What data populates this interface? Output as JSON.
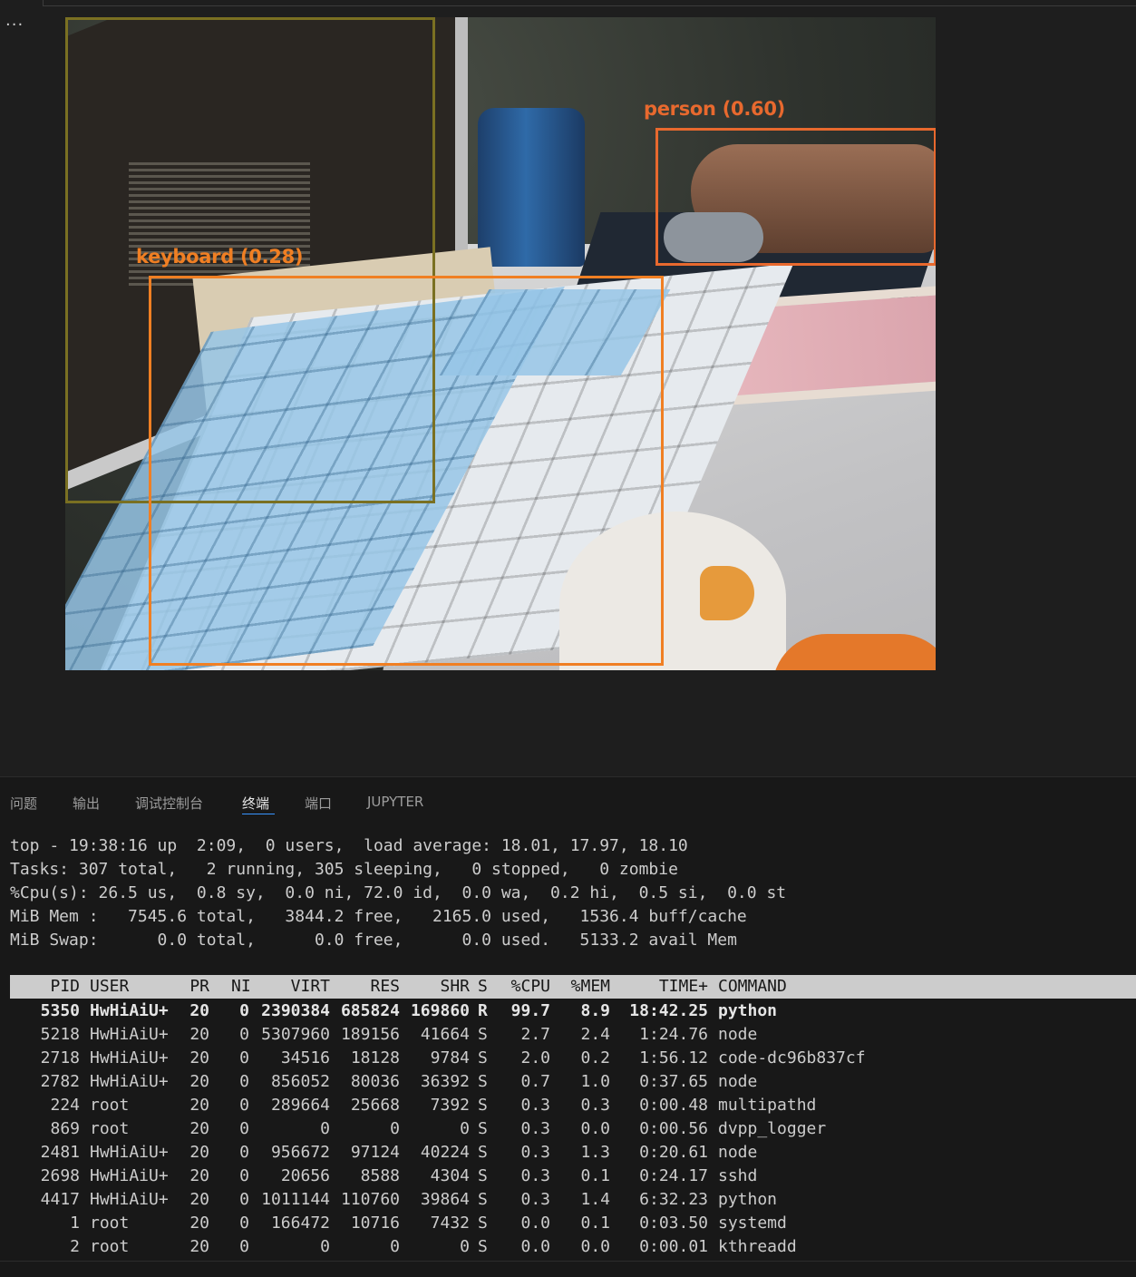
{
  "notebook": {
    "more_icon": "more-horizontal-icon",
    "detections": [
      {
        "label": "person (0.60)",
        "color": "#e8692e"
      },
      {
        "label": "keyboard (0.28)",
        "color": "#f07f23"
      },
      {
        "label": "",
        "color": "#7a7022"
      }
    ]
  },
  "panel": {
    "tabs": [
      "问题",
      "输出",
      "调试控制台",
      "终端",
      "端口",
      "JUPYTER"
    ],
    "active_tab": "终端"
  },
  "terminal": {
    "summary": [
      "top - 19:38:16 up  2:09,  0 users,  load average: 18.01, 17.97, 18.10",
      "Tasks: 307 total,   2 running, 305 sleeping,   0 stopped,   0 zombie",
      "%Cpu(s): 26.5 us,  0.8 sy,  0.0 ni, 72.0 id,  0.0 wa,  0.2 hi,  0.5 si,  0.0 st",
      "MiB Mem :   7545.6 total,   3844.2 free,   2165.0 used,   1536.4 buff/cache",
      "MiB Swap:      0.0 total,      0.0 free,      0.0 used.   5133.2 avail Mem"
    ],
    "columns": [
      "PID",
      "USER",
      "PR",
      "NI",
      "VIRT",
      "RES",
      "SHR",
      "S",
      "%CPU",
      "%MEM",
      "TIME+",
      "COMMAND"
    ],
    "processes": [
      [
        "5350",
        "HwHiAiU+",
        "20",
        "0",
        "2390384",
        "685824",
        "169860",
        "R",
        "99.7",
        "8.9",
        "18:42.25",
        "python"
      ],
      [
        "5218",
        "HwHiAiU+",
        "20",
        "0",
        "5307960",
        "189156",
        "41664",
        "S",
        "2.7",
        "2.4",
        "1:24.76",
        "node"
      ],
      [
        "2718",
        "HwHiAiU+",
        "20",
        "0",
        "34516",
        "18128",
        "9784",
        "S",
        "2.0",
        "0.2",
        "1:56.12",
        "code-dc96b837cf"
      ],
      [
        "2782",
        "HwHiAiU+",
        "20",
        "0",
        "856052",
        "80036",
        "36392",
        "S",
        "0.7",
        "1.0",
        "0:37.65",
        "node"
      ],
      [
        "224",
        "root",
        "20",
        "0",
        "289664",
        "25668",
        "7392",
        "S",
        "0.3",
        "0.3",
        "0:00.48",
        "multipathd"
      ],
      [
        "869",
        "root",
        "20",
        "0",
        "0",
        "0",
        "0",
        "S",
        "0.3",
        "0.0",
        "0:00.56",
        "dvpp_logger"
      ],
      [
        "2481",
        "HwHiAiU+",
        "20",
        "0",
        "956672",
        "97124",
        "40224",
        "S",
        "0.3",
        "1.3",
        "0:20.61",
        "node"
      ],
      [
        "2698",
        "HwHiAiU+",
        "20",
        "0",
        "20656",
        "8588",
        "4304",
        "S",
        "0.3",
        "0.1",
        "0:24.17",
        "sshd"
      ],
      [
        "4417",
        "HwHiAiU+",
        "20",
        "0",
        "1011144",
        "110760",
        "39864",
        "S",
        "0.3",
        "1.4",
        "6:32.23",
        "python"
      ],
      [
        "1",
        "root",
        "20",
        "0",
        "166472",
        "10716",
        "7432",
        "S",
        "0.0",
        "0.1",
        "0:03.50",
        "systemd"
      ],
      [
        "2",
        "root",
        "20",
        "0",
        "0",
        "0",
        "0",
        "S",
        "0.0",
        "0.0",
        "0:00.01",
        "kthreadd"
      ]
    ]
  }
}
